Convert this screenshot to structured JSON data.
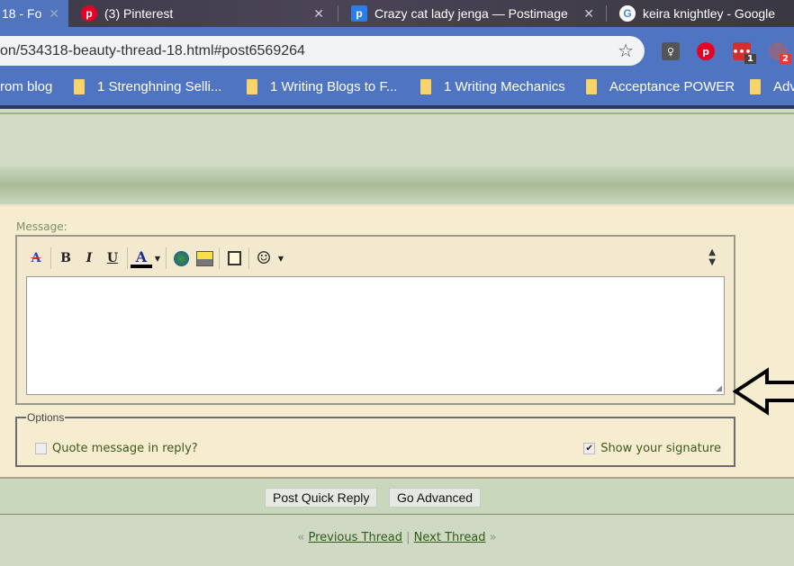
{
  "browser": {
    "tabs": [
      {
        "title": "18 - Fo",
        "active": true
      },
      {
        "title": "(3) Pinterest",
        "icon": "pinterest-icon"
      },
      {
        "title": "Crazy cat lady jenga — Postimage",
        "icon": "postimage-icon"
      },
      {
        "title": "keira knightley - Google",
        "icon": "google-icon"
      }
    ],
    "url": "on/534318-beauty-thread-18.html#post6569264",
    "extensions": [
      {
        "name": "lightbulb-extension",
        "badge": ""
      },
      {
        "name": "pinterest-extension",
        "badge": ""
      },
      {
        "name": "red-extension",
        "badge": "1"
      },
      {
        "name": "extension-4",
        "badge": "2"
      }
    ],
    "bookmarks": [
      "rom blog",
      "1 Strenghning Selli...",
      "1 Writing Blogs to F...",
      "1 Writing Mechanics",
      "Acceptance POWER",
      "Adv"
    ]
  },
  "reply": {
    "message_label": "Message:",
    "toolbar": [
      "remove-format",
      "bold",
      "italic",
      "underline",
      "font-color",
      "insert-link",
      "insert-image",
      "quote",
      "smilies"
    ],
    "message_value": "",
    "options_legend": "Options",
    "quote_label": "Quote message in reply?",
    "quote_checked": false,
    "signature_label": "Show your signature",
    "signature_checked": true,
    "post_button": "Post Quick Reply",
    "advanced_button": "Go Advanced"
  },
  "nav": {
    "prev_symbol": "«",
    "prev": "Previous Thread",
    "divider": "|",
    "next": "Next Thread",
    "next_symbol": "»"
  }
}
